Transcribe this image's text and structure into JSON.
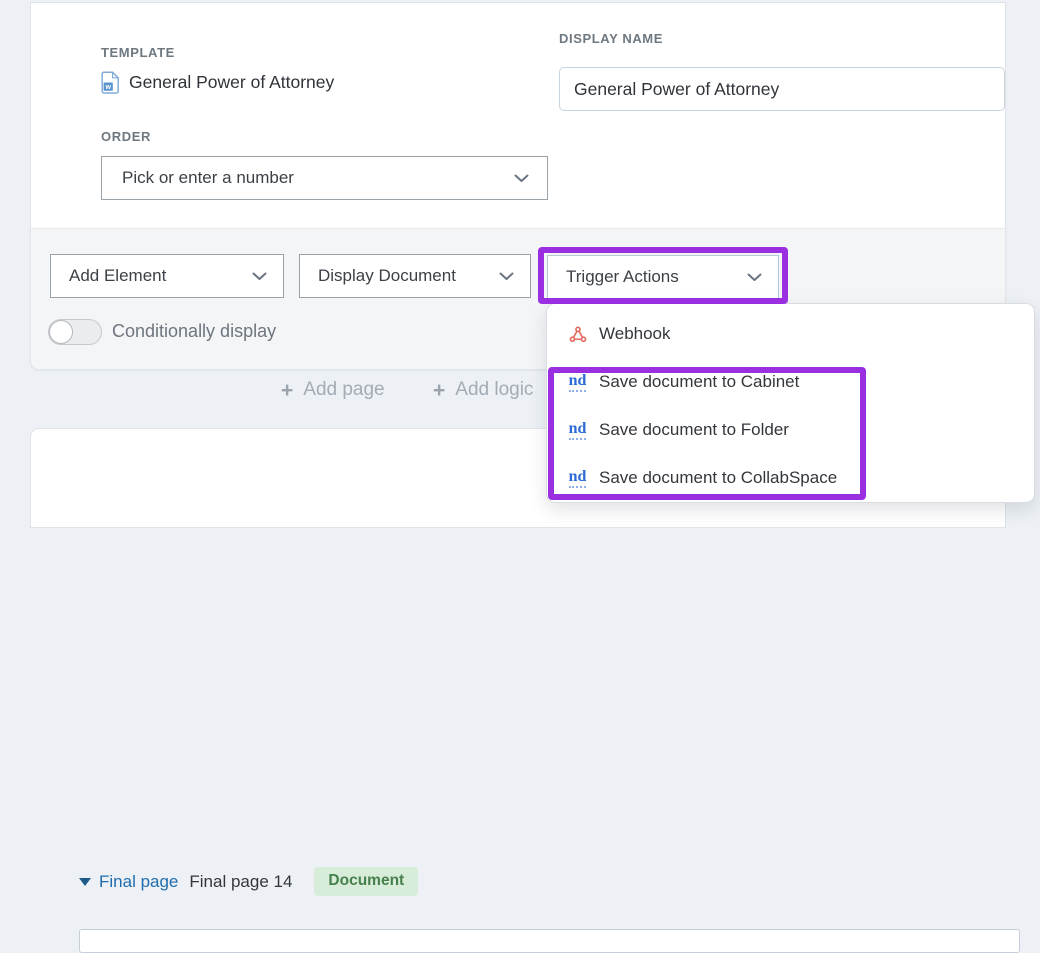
{
  "form": {
    "template": {
      "label": "TEMPLATE",
      "value": "General Power of Attorney"
    },
    "display_name": {
      "label": "DISPLAY NAME",
      "value": "General Power of Attorney"
    },
    "order": {
      "label": "ORDER",
      "placeholder": "Pick or enter a number"
    }
  },
  "toolbar": {
    "add_element": "Add Element",
    "display_document": "Display Document",
    "trigger_actions": "Trigger Actions",
    "conditionally_display": "Conditionally display"
  },
  "actions_menu": {
    "nd_icon_text": "nd",
    "items": [
      {
        "icon": "webhook-icon",
        "label": "Webhook"
      },
      {
        "icon": "netdocuments-icon",
        "label": "Save document to Cabinet"
      },
      {
        "icon": "netdocuments-icon",
        "label": "Save document to Folder"
      },
      {
        "icon": "netdocuments-icon",
        "label": "Save document to CollabSpace"
      }
    ]
  },
  "page_actions": {
    "plus_glyph": "+",
    "add_page": "Add page",
    "add_logic": "Add logic"
  },
  "final_page": {
    "link": "Final page",
    "title": "Final page 14",
    "badge": "Document"
  },
  "colors": {
    "annotation_purple": "#9a2fe1",
    "badge_bg": "#d8ecda",
    "badge_text": "#46814d",
    "webhook_red": "#e4695e",
    "nd_blue": "#2a6bd4",
    "link_blue": "#1e6cad"
  }
}
